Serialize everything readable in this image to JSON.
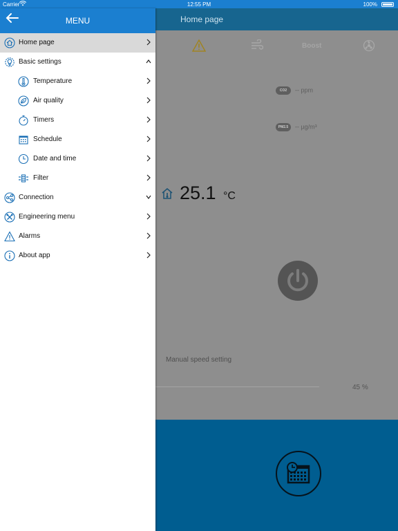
{
  "status_bar": {
    "carrier": "Carrier",
    "time": "12:55 PM",
    "battery": "100%"
  },
  "menu": {
    "title": "MENU",
    "items": [
      {
        "label": "Home page",
        "icon": "home-icon",
        "chevron": "right",
        "active": true
      },
      {
        "label": "Basic settings",
        "icon": "settings-bulb-icon",
        "chevron": "up"
      },
      {
        "label": "Temperature",
        "icon": "thermometer-icon",
        "chevron": "right"
      },
      {
        "label": "Air quality",
        "icon": "leaf-icon",
        "chevron": "right"
      },
      {
        "label": "Timers",
        "icon": "stopwatch-icon",
        "chevron": "right"
      },
      {
        "label": "Schedule",
        "icon": "calendar-icon",
        "chevron": "right"
      },
      {
        "label": "Date and time",
        "icon": "clock-icon",
        "chevron": "right"
      },
      {
        "label": "Filter",
        "icon": "filter-icon",
        "chevron": "right"
      },
      {
        "label": "Connection",
        "icon": "share-icon",
        "chevron": "down"
      },
      {
        "label": "Engineering menu",
        "icon": "tools-icon",
        "chevron": "right"
      },
      {
        "label": "Alarms",
        "icon": "warning-icon",
        "chevron": "right"
      },
      {
        "label": "About app",
        "icon": "info-icon",
        "chevron": "right"
      }
    ]
  },
  "home": {
    "title": "Home page",
    "boost_label": "Boost",
    "co2": {
      "badge": "CO2",
      "value": "-- ppm"
    },
    "pm25": {
      "badge": "PM2.5",
      "value": "-- µg/m³"
    },
    "temperature": {
      "value": "25.1",
      "unit": "°C"
    },
    "speed_label": "Manual speed setting",
    "speed_percent": "45 %",
    "speed_value": 45
  },
  "colors": {
    "header_blue": "#1b7fd0",
    "panel_blue": "#005d90",
    "menu_icon_blue": "#1a6fb5"
  }
}
